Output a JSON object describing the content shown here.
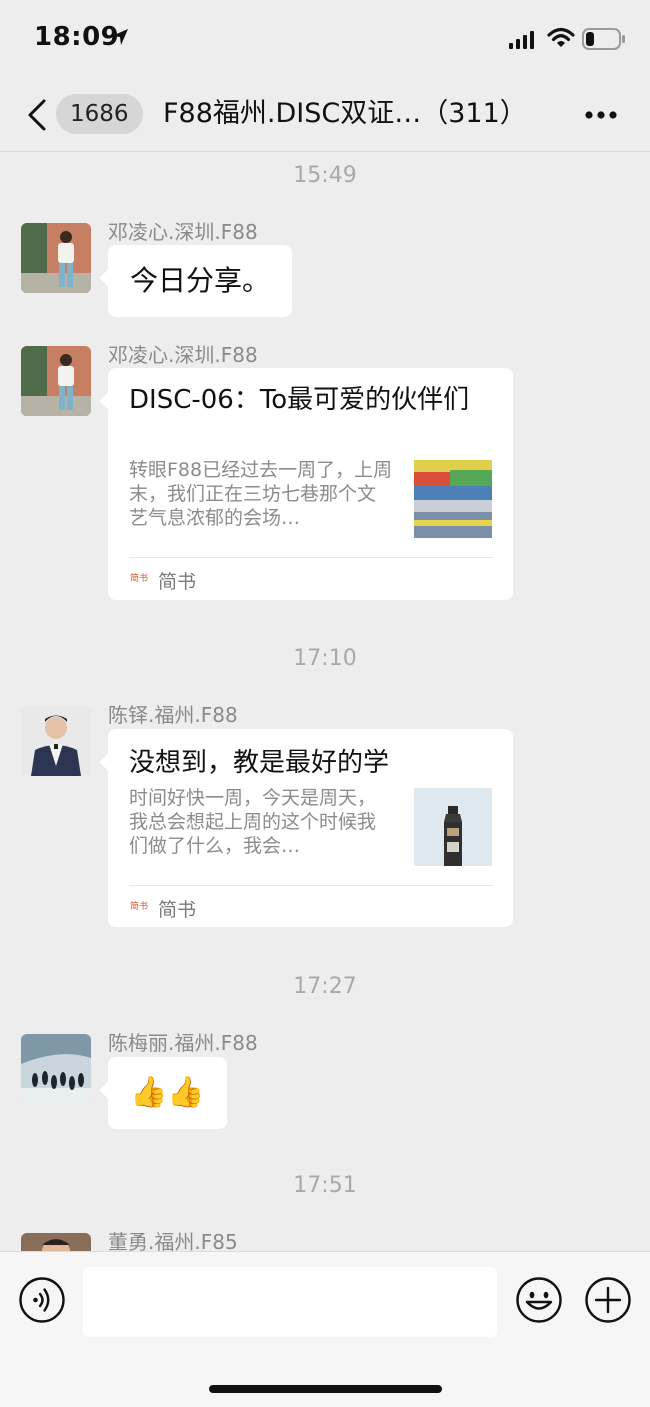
{
  "status_bar": {
    "time": "18:09"
  },
  "header": {
    "back_label": "back",
    "unread_count": "1686",
    "title": "F88福州.DISC双证…（311）"
  },
  "messages": [
    {
      "timestamp": "15:49",
      "sender": "邓凌心.深圳.F88",
      "text": "今日分享。"
    },
    {
      "sender": "邓凌心.深圳.F88",
      "card": {
        "title": "DISC-06：To最可爱的伙伴们",
        "description": "转眼F88已经过去一周了，上周末，我们正在三坊七巷那个文艺气息浓郁的会场…",
        "source_badge": "简书",
        "source": "简书"
      }
    },
    {
      "timestamp": "17:10",
      "sender": "陈铎.福州.F88",
      "card": {
        "title": "没想到，教是最好的学",
        "description": "时间好快一周，今天是周天，我总会想起上周的这个时候我们做了什么，我会…",
        "source_badge": "简书",
        "source": "简书"
      }
    },
    {
      "timestamp": "17:27",
      "sender": "陈梅丽.福州.F88",
      "text": "👍👍"
    },
    {
      "timestamp": "17:51",
      "sender": "董勇.福州.F85"
    }
  ],
  "input_bar": {
    "placeholder": ""
  },
  "icons": {
    "location": "location-arrow-icon",
    "signal": "cellular-signal-icon",
    "wifi": "wifi-icon",
    "battery": "battery-icon",
    "back": "chevron-left-icon",
    "more": "more-dots-icon",
    "voice": "voice-icon",
    "emoji": "emoji-icon",
    "plus": "plus-icon"
  }
}
